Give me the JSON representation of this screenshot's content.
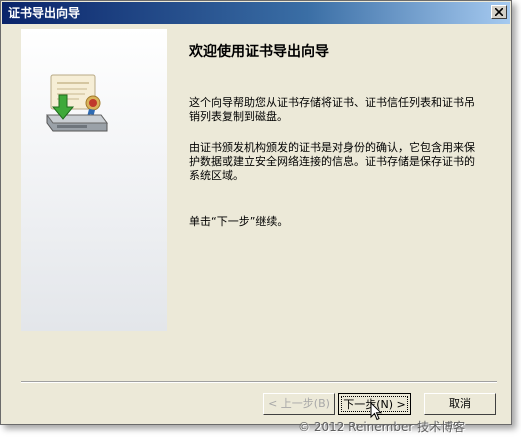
{
  "window": {
    "title": "证书导出向导"
  },
  "wizard": {
    "heading": "欢迎使用证书导出向导",
    "paragraph1": "这个向导帮助您从证书存储将证书、证书信任列表和证书吊销列表复制到磁盘。",
    "paragraph2": "由证书颁发机构颁发的证书是对身份的确认，它包含用来保护数据或建立安全网络连接的信息。证书存储是保存证书的系统区域。",
    "paragraph3": "单击“下一步”继续。"
  },
  "buttons": {
    "back": "< 上一步(B)",
    "next": "下一步(N) >",
    "cancel": "取消"
  },
  "watermark": "© 2012 Reinember 技术博客",
  "icons": [
    "certificate-export-icon",
    "close-icon",
    "mouse-cursor-icon"
  ],
  "colors": {
    "title_bar_start": "#0a246a",
    "title_bar_end": "#a6caf0",
    "dialog_bg": "#ece9d8",
    "seal_red": "#c0392b",
    "arrow_green": "#3fa93a"
  }
}
